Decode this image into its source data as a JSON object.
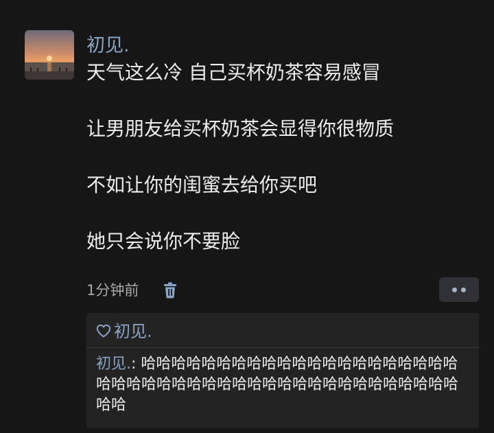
{
  "post": {
    "username": "初见.",
    "lines": [
      "天气这么冷  自己买杯奶茶容易感冒",
      "让男朋友给买杯奶茶会显得你很物质",
      "不如让你的闺蜜去给你买吧",
      "她只会说你不要脸"
    ],
    "time": "1分钟前",
    "delete_icon": "trash-icon",
    "more_icon": "more-dots-icon"
  },
  "comments": {
    "like_icon": "heart-outline-icon",
    "liked_by": "初见.",
    "items": [
      {
        "author": "初见.",
        "separator": ": ",
        "text": "哈哈哈哈哈哈哈哈哈哈哈哈哈哈哈哈哈哈哈哈哈哈哈哈哈哈哈哈哈哈哈哈哈哈哈哈哈哈哈哈哈哈哈哈哈哈哈"
      }
    ]
  },
  "colors": {
    "background": "#161616",
    "username": "#8aa4c8",
    "text": "#ededed",
    "muted": "#a9a9a9",
    "comment_bg": "#232323"
  }
}
